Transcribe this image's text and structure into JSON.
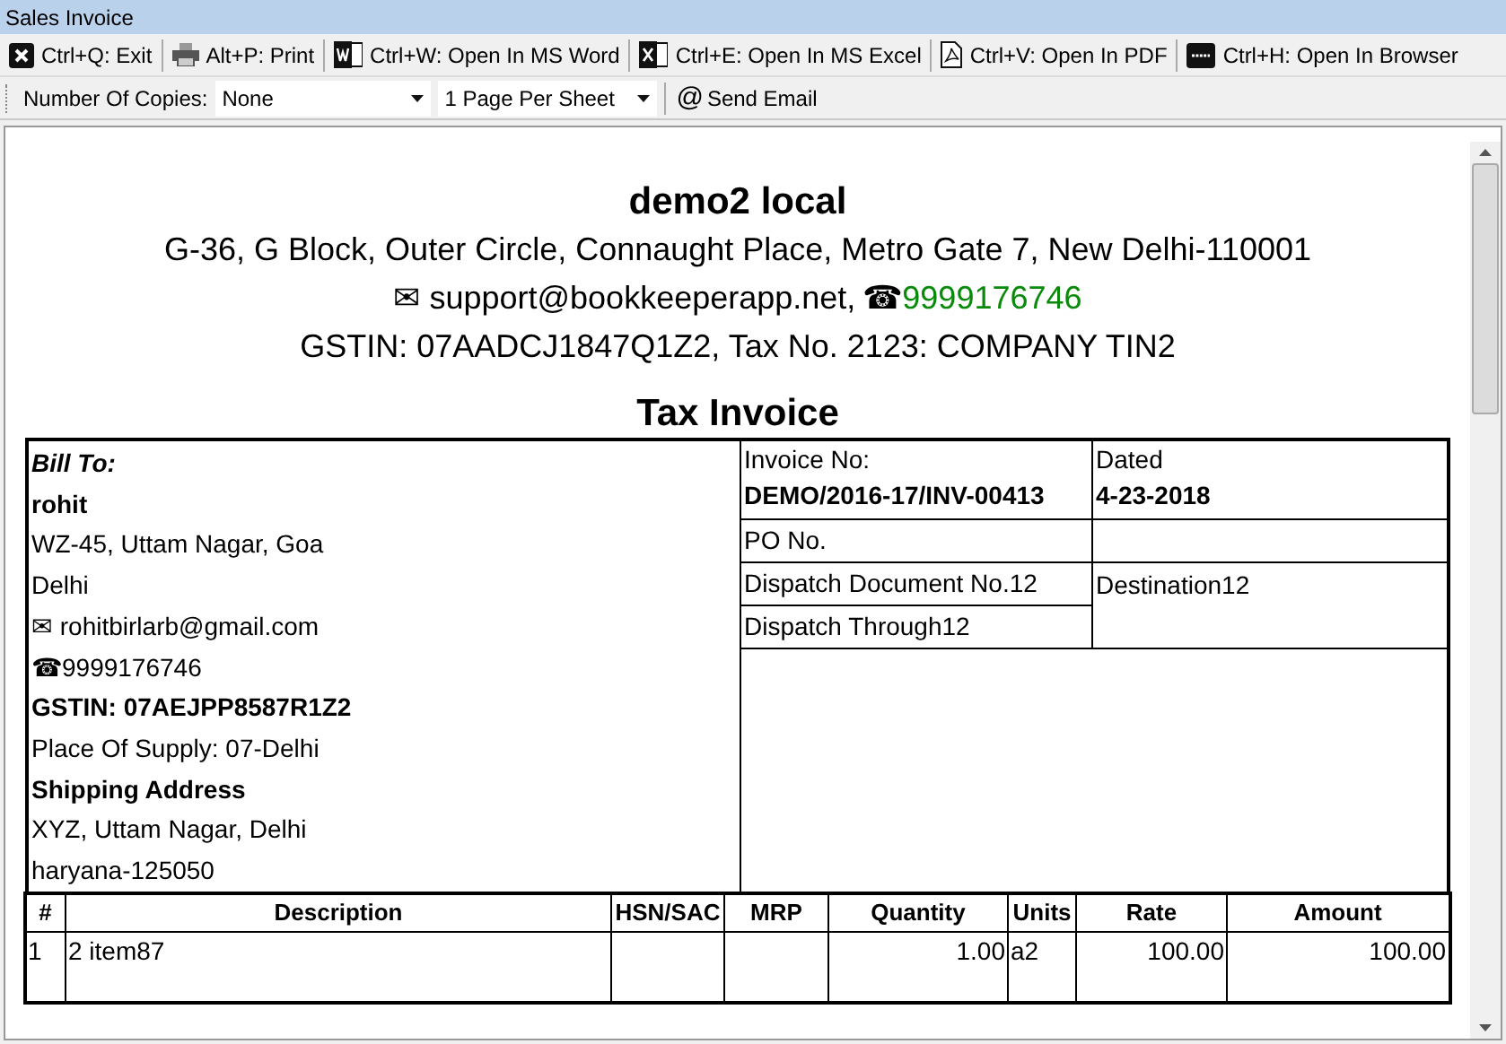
{
  "window": {
    "title": "Sales Invoice"
  },
  "toolbar": [
    {
      "kind": "exit",
      "label": "Ctrl+Q: Exit"
    },
    {
      "kind": "print",
      "label": "Alt+P: Print"
    },
    {
      "kind": "word",
      "label": "Ctrl+W: Open In MS Word"
    },
    {
      "kind": "excel",
      "label": "Ctrl+E: Open In MS Excel"
    },
    {
      "kind": "pdf",
      "label": "Ctrl+V: Open In PDF"
    },
    {
      "kind": "html",
      "label": "Ctrl+H: Open In Browser"
    }
  ],
  "options": {
    "copies_label": "Number Of Copies:",
    "copies_value": "None",
    "pages_value": "1 Page Per Sheet",
    "send_email_icon": "@",
    "send_email": "Send Email"
  },
  "company": {
    "name": "demo2 local",
    "address": "G-36, G Block, Outer Circle, Connaught Place, Metro Gate 7, New Delhi-110001",
    "email": "✉ support@bookkeeperapp.net,",
    "phone_icon": "☎",
    "phone": "9999176746",
    "tax_line": "GSTIN: 07AADCJ1847Q1Z2, Tax No. 2123: COMPANY TIN2"
  },
  "document_title": "Tax Invoice",
  "bill_to": [
    {
      "kind": "heading",
      "text": "Bill To:"
    },
    {
      "kind": "bold",
      "text": "rohit"
    },
    {
      "kind": "plain",
      "text": "WZ-45, Uttam Nagar, Goa"
    },
    {
      "kind": "plain",
      "text": "Delhi"
    },
    {
      "kind": "plain",
      "text": "✉ rohitbirlarb@gmail.com"
    },
    {
      "kind": "plain",
      "text": "☎9999176746"
    },
    {
      "kind": "bold",
      "text": "GSTIN: 07AEJPP8587R1Z2"
    },
    {
      "kind": "plain",
      "text": "Place Of Supply: 07-Delhi"
    },
    {
      "kind": "bold",
      "text": "Shipping Address"
    },
    {
      "kind": "plain",
      "text": "XYZ, Uttam Nagar, Delhi"
    },
    {
      "kind": "plain",
      "text": "haryana-125050"
    }
  ],
  "invoice_details": {
    "invoice_no_label": "Invoice No:",
    "invoice_no": "DEMO/2016-17/INV-00413",
    "dated_label": "Dated",
    "dated": "4-23-2018",
    "po_label": "PO No.",
    "dispatch_document": "Dispatch Document No.12",
    "destination": "Destination12",
    "dispatch_through": "Dispatch Through12"
  },
  "items": {
    "columns": [
      "#",
      "Description",
      "HSN/SAC",
      "MRP",
      "Quantity",
      "Units",
      "Rate",
      "Amount"
    ],
    "rows": [
      [
        "1",
        "2 item87",
        "",
        "",
        "1.00",
        "a2",
        "100.00",
        "100.00"
      ]
    ]
  }
}
